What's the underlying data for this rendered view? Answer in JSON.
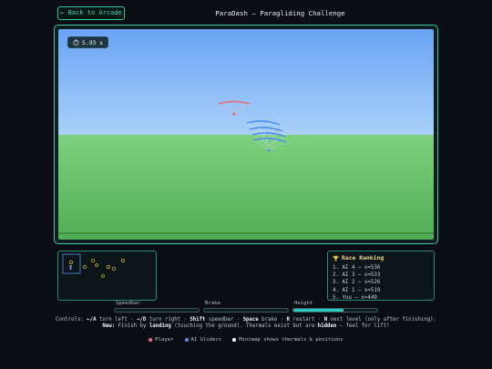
{
  "header": {
    "back_label": "← Back to Arcade",
    "title": "ParaDash — Paragliding Challenge"
  },
  "game": {
    "timer_icon": "stopwatch-icon",
    "timer": "5.93 s",
    "colors": {
      "sky_top": "#6aa4f4",
      "sky_bottom": "#a9d0f9",
      "ground_top": "#7fd17f",
      "ground_bottom": "#4fae53",
      "player": "#e86b7a",
      "ai": "#4e8df0"
    }
  },
  "ranking": {
    "icon": "trophy-icon",
    "title": "Race Ranking",
    "items": [
      "1. AI 4 — x=536",
      "2. AI 3 — x=533",
      "3. AI 2 — x=526",
      "4. AI 1 — x=519",
      "5. You — x=449"
    ]
  },
  "bars": {
    "speedbar": {
      "label": "Speedbar",
      "value": 0
    },
    "brake": {
      "label": "Brake",
      "value": 0
    },
    "height": {
      "label": "Height",
      "value": 0.6
    }
  },
  "controls": {
    "p1": "Controls:",
    "k_left": "←/A",
    "t_left": "turn left ·",
    "k_right": "→/D",
    "t_right": "turn right ·",
    "k_shift": "Shift",
    "t_shift": "speedbar ·",
    "k_space": "Space",
    "t_space": "brake ·",
    "k_r": "R",
    "t_r": "restart ·",
    "k_n": "N",
    "t_n": "next level (only after finishing).",
    "k_new": "New:",
    "t_new1": "Finish by",
    "k_landing": "landing",
    "t_new2": "(touching the ground). Thermals exist but are",
    "k_hidden": "hidden",
    "t_new3": "— feel for lift!"
  },
  "legend": {
    "player": "Player",
    "ai": "AI Gliders",
    "minimap": "Minimap shows thermals & positions",
    "colors": {
      "player": "#f0698a",
      "ai": "#5a8ff0",
      "minimap": "#ffffff"
    }
  }
}
